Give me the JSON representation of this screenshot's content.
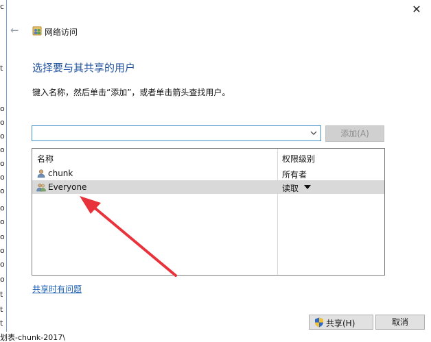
{
  "window": {
    "title": "网络访问",
    "close_glyph": "✕",
    "back_glyph": "←"
  },
  "dialog": {
    "heading": "选择要与其共享的用户",
    "instruction": "键入名称，然后单击“添加”，或者单击箭头查找用户。",
    "name_input_value": "",
    "add_button": "添加(A)"
  },
  "table": {
    "headers": {
      "name": "名称",
      "permission": "权限级别"
    },
    "rows": [
      {
        "name": "chunk",
        "permission": "所有者",
        "selected": false,
        "icon": "user-icon"
      },
      {
        "name": "Everyone",
        "permission": "读取",
        "selected": true,
        "icon": "group-icon"
      }
    ]
  },
  "footer": {
    "trouble_link": "共享时有问题",
    "share_button": "共享(H)",
    "cancel_button": "取消"
  },
  "background": {
    "bottom_text": "划表-chunk-2017\\"
  },
  "colors": {
    "heading": "#1e4f9c",
    "link": "#1a5fb4",
    "annotation_arrow": "#e8323c",
    "selected_row": "#d9d9d9",
    "input_border": "#3d8ec9"
  }
}
